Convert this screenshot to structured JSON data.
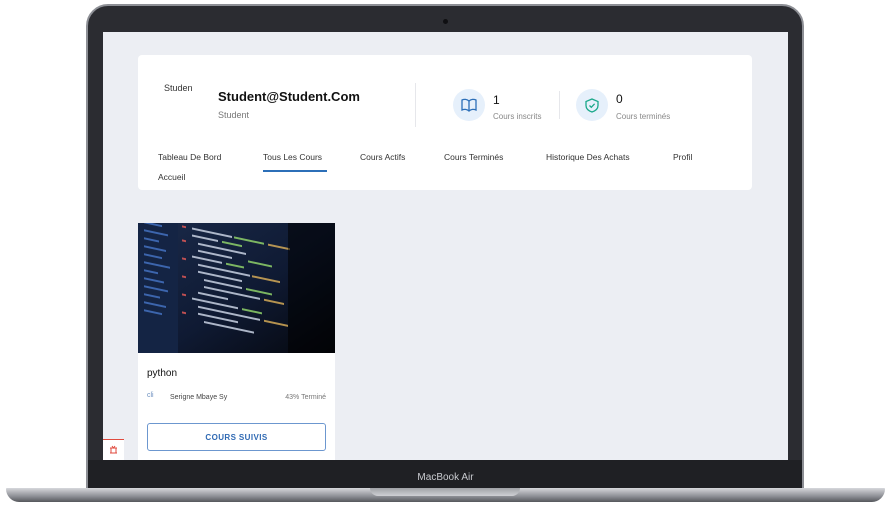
{
  "device": {
    "label": "MacBook Air"
  },
  "profile": {
    "avatar_alt": "Studen",
    "name": "Student@Student.Com",
    "role": "Student"
  },
  "stats": [
    {
      "value": "1",
      "label": "Cours inscrits",
      "icon": "book-icon"
    },
    {
      "value": "0",
      "label": "Cours terminés",
      "icon": "shield-check-icon"
    }
  ],
  "tabs": [
    {
      "label": "Tableau De Bord"
    },
    {
      "label": "Tous Les Cours",
      "active": true
    },
    {
      "label": "Cours Actifs"
    },
    {
      "label": "Cours Terminés"
    },
    {
      "label": "Historique Des Achats"
    },
    {
      "label": "Profil"
    },
    {
      "label": "Accueil"
    }
  ],
  "course": {
    "title": "python",
    "author_img_alt": "cli",
    "author": "Serigne Mbaye Sy",
    "progress_text": "43% Terminé",
    "progress": 43,
    "button_label": "COURS SUIVIS"
  },
  "colors": {
    "accent": "#2c6fb8",
    "progress": "#f07a36",
    "background": "#eceef3"
  }
}
